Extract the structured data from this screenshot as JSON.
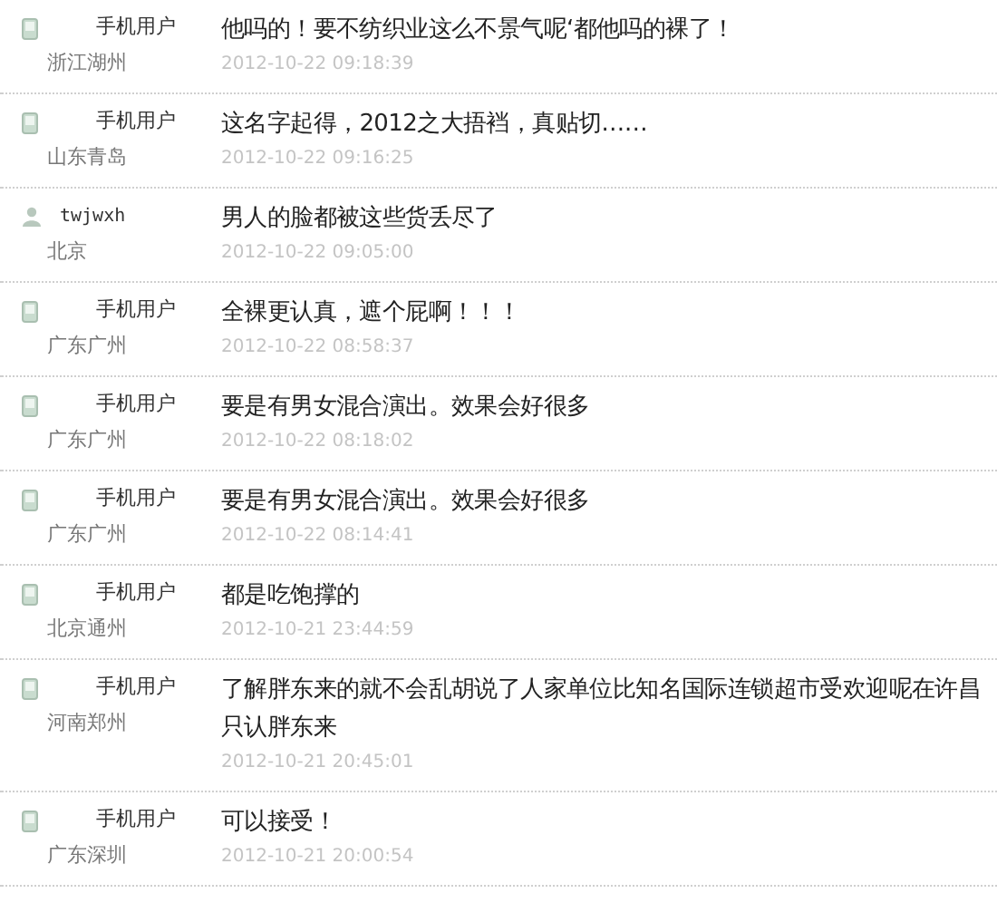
{
  "comments": [
    {
      "kind": "mobile",
      "user": "手机用户",
      "location": "浙江湖州",
      "text": "他吗的！要不纺织业这么不景气呢‘都他吗的裸了！",
      "time": "2012-10-22 09:18:39"
    },
    {
      "kind": "mobile",
      "user": "手机用户",
      "location": "山东青岛",
      "text": "这名字起得，2012之大捂裆，真贴切……",
      "time": "2012-10-22 09:16:25"
    },
    {
      "kind": "registered",
      "user": "twjwxh",
      "location": "北京",
      "text": "男人的脸都被这些货丢尽了",
      "time": "2012-10-22 09:05:00"
    },
    {
      "kind": "mobile",
      "user": "手机用户",
      "location": "广东广州",
      "text": "全裸更认真，遮个屁啊！！！",
      "time": "2012-10-22 08:58:37"
    },
    {
      "kind": "mobile",
      "user": "手机用户",
      "location": "广东广州",
      "text": "要是有男女混合演出。效果会好很多",
      "time": "2012-10-22 08:18:02"
    },
    {
      "kind": "mobile",
      "user": "手机用户",
      "location": "广东广州",
      "text": "要是有男女混合演出。效果会好很多",
      "time": "2012-10-22 08:14:41"
    },
    {
      "kind": "mobile",
      "user": "手机用户",
      "location": "北京通州",
      "text": "都是吃饱撑的",
      "time": "2012-10-21 23:44:59"
    },
    {
      "kind": "mobile",
      "user": "手机用户",
      "location": "河南郑州",
      "text": "了解胖东来的就不会乱胡说了人家单位比知名国际连锁超市受欢迎呢在许昌只认胖东来",
      "time": "2012-10-21 20:45:01"
    },
    {
      "kind": "mobile",
      "user": "手机用户",
      "location": "广东深圳",
      "text": "可以接受！",
      "time": "2012-10-21 20:00:54"
    }
  ]
}
